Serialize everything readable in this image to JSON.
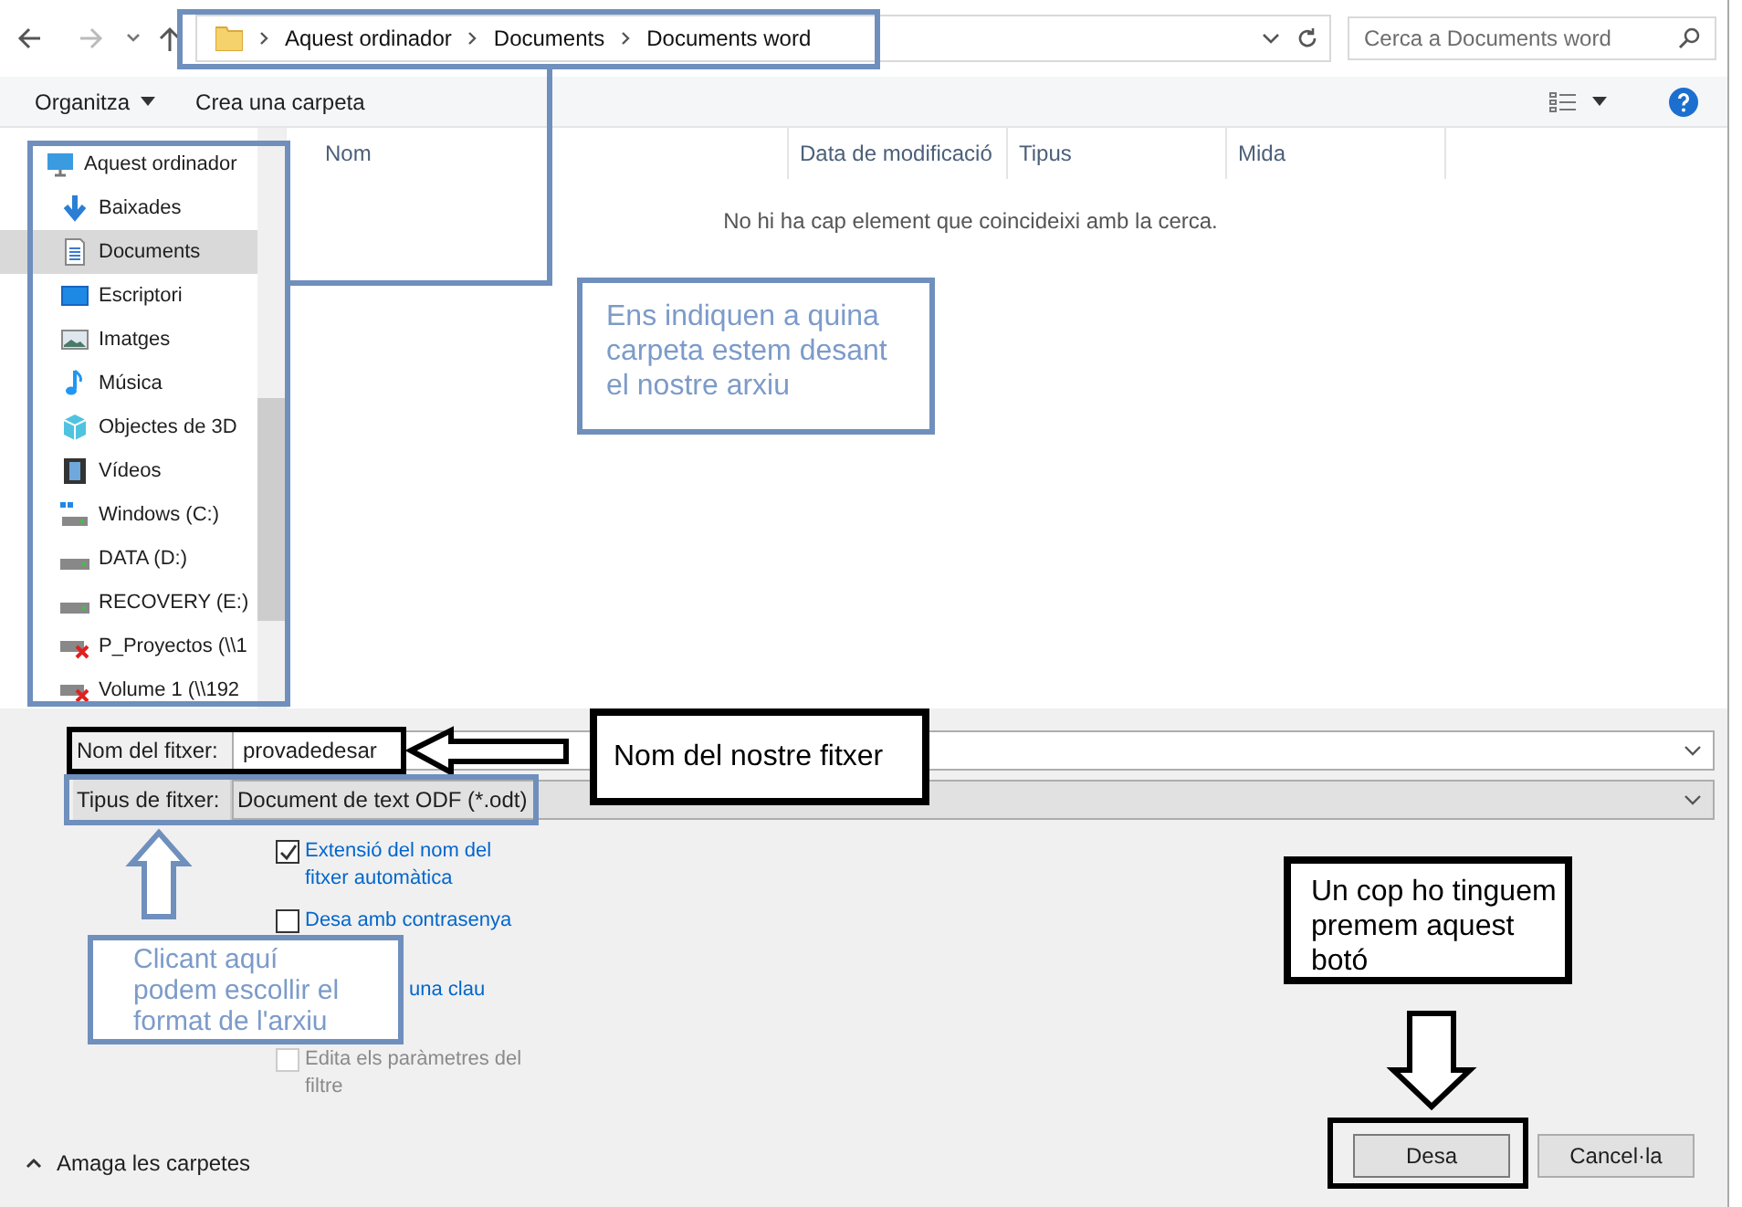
{
  "address_bar": {
    "breadcrumbs": [
      "Aquest ordinador",
      "Documents",
      "Documents word"
    ]
  },
  "search": {
    "placeholder": "Cerca a Documents word"
  },
  "toolbar": {
    "organize": "Organitza",
    "new_folder": "Crea una carpeta"
  },
  "sidebar": {
    "items": [
      {
        "label": "Aquest ordinador",
        "kind": "pc",
        "selected": false,
        "children": [
          {
            "label": "Baixades",
            "kind": "download",
            "selected": false
          },
          {
            "label": "Documents",
            "kind": "doc",
            "selected": true
          },
          {
            "label": "Escriptori",
            "kind": "desktop",
            "selected": false
          },
          {
            "label": "Imatges",
            "kind": "image",
            "selected": false
          },
          {
            "label": "Música",
            "kind": "music",
            "selected": false
          },
          {
            "label": "Objectes de 3D",
            "kind": "cube",
            "selected": false
          },
          {
            "label": "Vídeos",
            "kind": "video",
            "selected": false
          },
          {
            "label": "Windows (C:)",
            "kind": "windrive",
            "selected": false
          },
          {
            "label": "DATA (D:)",
            "kind": "drive",
            "selected": false
          },
          {
            "label": "RECOVERY (E:)",
            "kind": "drive",
            "selected": false
          },
          {
            "label": "P_Proyectos (\\\\1",
            "kind": "netdrive",
            "selected": false
          },
          {
            "label": "Volume 1 (\\\\192",
            "kind": "netdrive",
            "selected": false
          }
        ]
      }
    ]
  },
  "table": {
    "columns": [
      "Nom",
      "Data de modificació",
      "Tipus",
      "Mida"
    ],
    "empty_message": "No hi ha cap element que coincideixi amb la cerca."
  },
  "file_name": {
    "label": "Nom del fitxer:",
    "value": "provadedesar"
  },
  "file_type": {
    "label": "Tipus de fitxer:",
    "value": "Document de text ODF (*.odt)"
  },
  "options": [
    {
      "kind": "checkbox",
      "text": "Extensió del nom del fitxer automàtica",
      "checked": true,
      "disabled": false
    },
    {
      "kind": "checkbox",
      "text": "Desa amb contrasenya",
      "checked": false,
      "disabled": false
    },
    {
      "kind": "text",
      "text": "una clau",
      "disabled": false
    },
    {
      "kind": "checkbox",
      "text": "Edita els paràmetres del filtre",
      "checked": false,
      "disabled": true
    }
  ],
  "hide_folders": "Amaga les carpetes",
  "buttons": [
    {
      "label": "Desa",
      "kind": "primary"
    },
    {
      "label": "Cancel·la",
      "kind": "secondary"
    }
  ],
  "annotations": [
    {
      "text": "Ens indiquen a quina carpeta estem desant el nostre arxiu",
      "color": "#6f8fbd"
    },
    {
      "text": "Nom del nostre fitxer",
      "color": "#000000"
    },
    {
      "text": "Clicant aquí podem escollir el format de l'arxiu",
      "color": "#6f8fbd"
    },
    {
      "text": "Un cop ho tinguem premem aquest botó",
      "color": "#000000"
    }
  ]
}
